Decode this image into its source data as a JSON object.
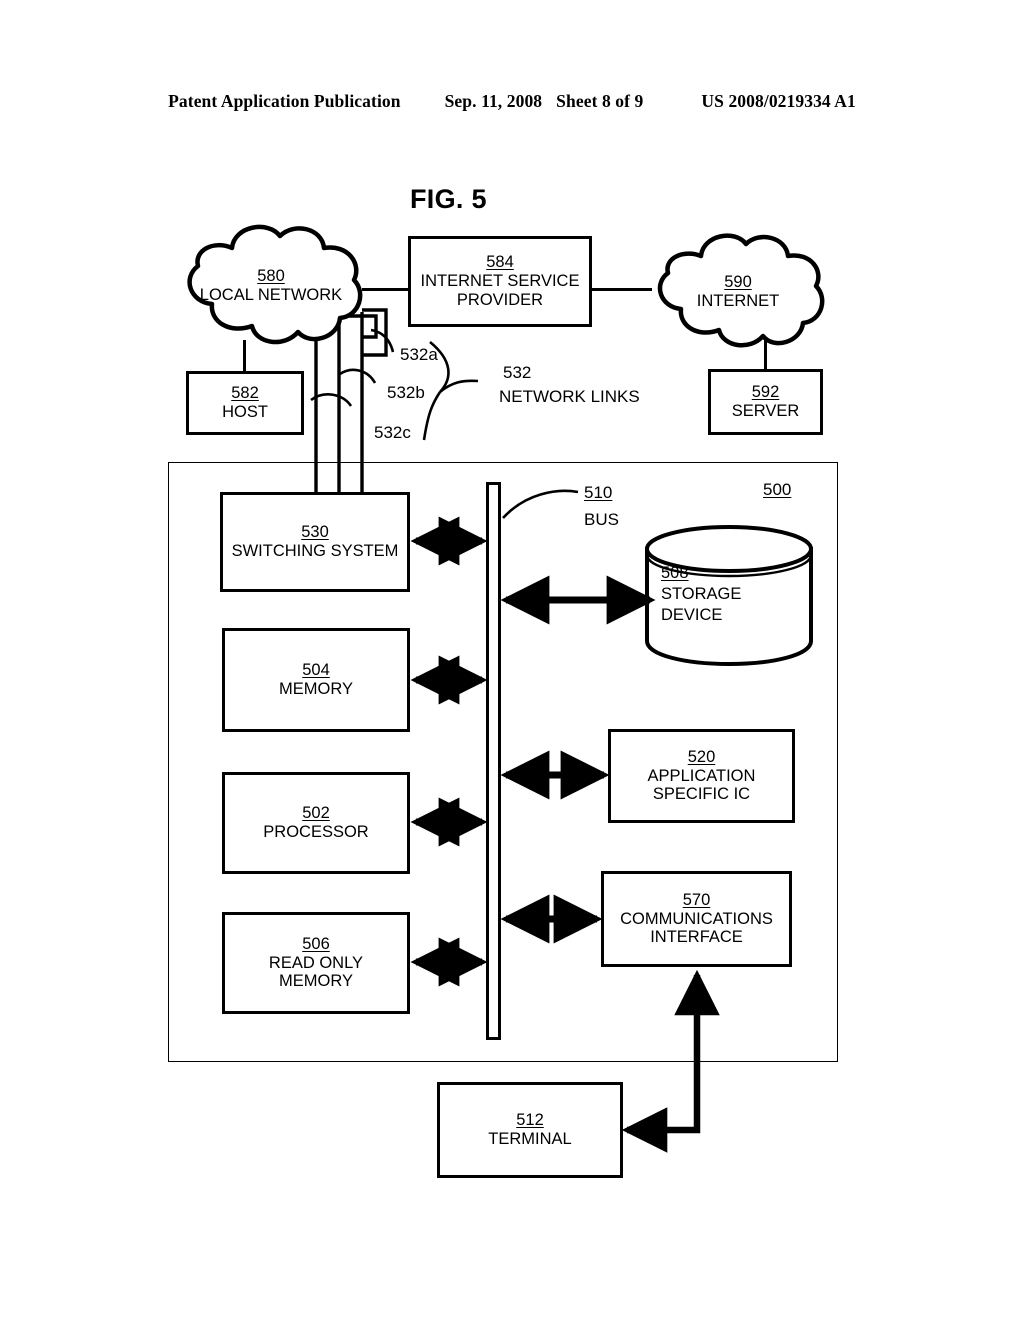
{
  "header": {
    "publication": "Patent Application Publication",
    "date": "Sep. 11, 2008",
    "sheet": "Sheet 8 of 9",
    "patent_number": "US 2008/0219334 A1"
  },
  "figure": {
    "title": "FIG. 5",
    "system_ref": "500"
  },
  "clouds": [
    {
      "ref": "580",
      "label": "LOCAL NETWORK"
    },
    {
      "ref": "590",
      "label": "INTERNET"
    }
  ],
  "nodes": {
    "isp": {
      "ref": "584",
      "label": "INTERNET SERVICE\nPROVIDER"
    },
    "host": {
      "ref": "582",
      "label": "HOST"
    },
    "server": {
      "ref": "592",
      "label": "SERVER"
    },
    "switching": {
      "ref": "530",
      "label": "SWITCHING SYSTEM"
    },
    "memory": {
      "ref": "504",
      "label": "MEMORY"
    },
    "processor": {
      "ref": "502",
      "label": "PROCESSOR"
    },
    "rom": {
      "ref": "506",
      "label": "READ ONLY\nMEMORY"
    },
    "asic": {
      "ref": "520",
      "label": "APPLICATION\nSPECIFIC IC"
    },
    "comms": {
      "ref": "570",
      "label": "COMMUNICATIONS\nINTERFACE"
    },
    "terminal": {
      "ref": "512",
      "label": "TERMINAL"
    },
    "storage": {
      "ref": "508",
      "label": "STORAGE\nDEVICE"
    }
  },
  "annotations": {
    "bus": {
      "ref": "510",
      "label": "BUS"
    },
    "network_links": {
      "ref": "532",
      "label": "NETWORK LINKS"
    },
    "link_a": "532a",
    "link_b": "532b",
    "link_c": "532c"
  },
  "colors": {
    "ink": "#000000",
    "paper": "#ffffff"
  }
}
